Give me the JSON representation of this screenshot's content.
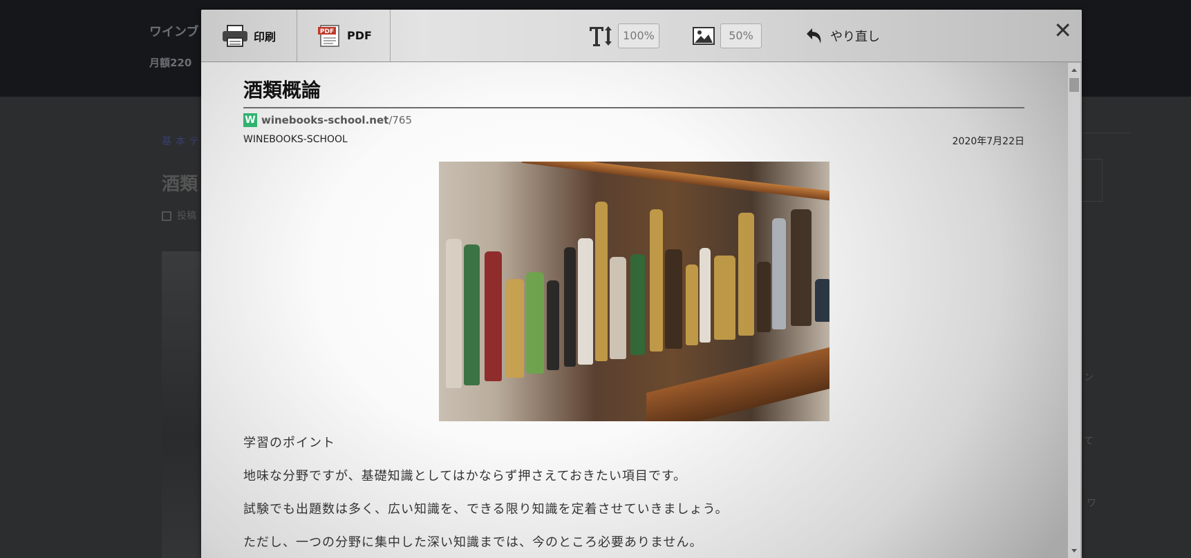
{
  "background_page": {
    "site_title": "ワインブ",
    "site_subtitle": "月額220",
    "breadcrumb": "基本テ",
    "article_title": "酒類",
    "posted_label": "投稿",
    "right_texts": [
      "ン",
      "て",
      "ワ"
    ]
  },
  "toolbar": {
    "print_label": "印刷",
    "pdf_label": "PDF",
    "text_size_value": "100%",
    "image_size_value": "50%",
    "undo_label": "やり直し",
    "close_symbol": "✕"
  },
  "article": {
    "title": "酒類概論",
    "source_logo": "W",
    "source_domain": "winebooks-school.net",
    "source_path": "/765",
    "author": "WINEBOOKS-SCHOOL",
    "date": "2020年7月22日",
    "paragraphs": [
      "学習のポイント",
      "地味な分野ですが、基礎知識としてはかならず押さえておきたい項目です。",
      "試験でも出題数は多く、広い知識を、できる限り知識を定着させていきましょう。",
      "ただし、一つの分野に集中した深い知識までは、今のところ必要ありません。"
    ]
  },
  "colors": {
    "logo_green": "#2fb36f",
    "overlay_dark": "#1b1c1e"
  }
}
